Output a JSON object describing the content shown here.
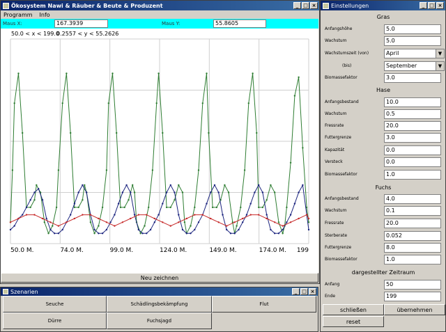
{
  "main": {
    "title": "Ökosystem Nawi  &  Räuber  &  Beute  &  Produzent",
    "menu": [
      "Programm",
      "Info"
    ],
    "mouse_x_label": "Maus X:",
    "mouse_x_value": "167.3939",
    "mouse_y_label": "Maus Y:",
    "mouse_y_value": "55.8605",
    "range_x": "50.0 < x < 199.0",
    "range_y": "0.2557 < y < 55.2626",
    "redraw_label": "Neu zeichnen"
  },
  "chart_data": {
    "type": "line",
    "x_ticks": [
      "50.0 M.",
      "74.0 M.",
      "99.0 M.",
      "124.0 M.",
      "149.0 M.",
      "174.0 M.",
      "199"
    ],
    "xlim": [
      50,
      199
    ],
    "ylim": [
      0.2557,
      55.2626
    ],
    "grid": true,
    "series": [
      {
        "color": "#2e7d32",
        "x": [
          50,
          51,
          52,
          54,
          56,
          58,
          60,
          62,
          63,
          65,
          67,
          69,
          71,
          73,
          74,
          76,
          78,
          80,
          82,
          84,
          86,
          87,
          88,
          90,
          92,
          94,
          96,
          98,
          99,
          101,
          103,
          105,
          107,
          109,
          111,
          112,
          113,
          115,
          117,
          119,
          121,
          123,
          124,
          126,
          128,
          130,
          132,
          134,
          136,
          137,
          138,
          140,
          142,
          144,
          146,
          148,
          149,
          151,
          153,
          155,
          157,
          159,
          161,
          162,
          163,
          165,
          167,
          169,
          171,
          173,
          174,
          176,
          178,
          180,
          182,
          184,
          186,
          187,
          188,
          190,
          192,
          194,
          196,
          198,
          199
        ],
        "values": [
          6,
          20,
          38,
          46,
          30,
          10,
          10,
          12,
          16,
          14,
          6,
          3,
          5,
          10,
          20,
          38,
          46,
          30,
          10,
          10,
          12,
          16,
          14,
          6,
          3,
          5,
          10,
          20,
          38,
          46,
          30,
          10,
          10,
          12,
          16,
          14,
          6,
          3,
          5,
          10,
          20,
          38,
          46,
          30,
          10,
          10,
          12,
          16,
          14,
          6,
          3,
          5,
          10,
          20,
          38,
          46,
          30,
          10,
          10,
          12,
          16,
          14,
          6,
          3,
          5,
          10,
          20,
          38,
          46,
          30,
          10,
          10,
          12,
          16,
          14,
          6,
          3,
          5,
          10,
          22,
          40,
          45,
          26,
          10,
          6
        ]
      },
      {
        "color": "#1a237e",
        "x": [
          50,
          52,
          54,
          56,
          58,
          60,
          62,
          64,
          66,
          68,
          70,
          72,
          74,
          76,
          78,
          80,
          82,
          84,
          86,
          88,
          90,
          92,
          94,
          96,
          98,
          100,
          102,
          104,
          106,
          108,
          110,
          112,
          114,
          116,
          118,
          120,
          122,
          124,
          126,
          128,
          130,
          132,
          134,
          136,
          138,
          140,
          142,
          144,
          146,
          148,
          150,
          152,
          154,
          156,
          158,
          160,
          162,
          164,
          166,
          168,
          170,
          172,
          174,
          176,
          178,
          180,
          182,
          184,
          186,
          188,
          190,
          192,
          194,
          196,
          198,
          199
        ],
        "values": [
          4,
          5,
          7,
          8,
          10,
          12,
          14,
          15,
          12,
          7,
          4,
          3,
          3,
          4,
          6,
          8,
          11,
          14,
          16,
          14,
          8,
          4,
          3,
          3,
          4,
          6,
          8,
          11,
          14,
          16,
          14,
          8,
          4,
          3,
          3,
          4,
          6,
          8,
          11,
          14,
          16,
          14,
          8,
          4,
          3,
          3,
          4,
          6,
          8,
          11,
          14,
          16,
          14,
          8,
          4,
          3,
          3,
          4,
          6,
          8,
          11,
          14,
          16,
          14,
          8,
          4,
          3,
          3,
          4,
          6,
          8,
          11,
          14,
          16,
          8,
          4
        ]
      },
      {
        "color": "#c62828",
        "x": [
          50,
          54,
          58,
          62,
          66,
          70,
          74,
          78,
          82,
          86,
          90,
          94,
          98,
          102,
          106,
          110,
          114,
          118,
          122,
          126,
          130,
          134,
          138,
          142,
          146,
          150,
          154,
          158,
          162,
          166,
          170,
          174,
          178,
          182,
          186,
          190,
          194,
          198,
          199
        ],
        "values": [
          6,
          7,
          8,
          8,
          7,
          6,
          5,
          6,
          7,
          8,
          8,
          7,
          6,
          5,
          6,
          7,
          8,
          8,
          7,
          6,
          5,
          6,
          7,
          8,
          8,
          7,
          6,
          5,
          6,
          7,
          8,
          8,
          7,
          6,
          5,
          6,
          7,
          8,
          7
        ]
      }
    ]
  },
  "settings": {
    "title": "Einstellungen",
    "grass_header": "Gras",
    "grass": [
      {
        "label": "Anfangshöhe",
        "value": "5.0"
      },
      {
        "label": "Wachstum",
        "value": "5.0"
      }
    ],
    "growth_from_label": "Wachstumszeit (von)",
    "growth_from_value": "April",
    "growth_to_label": "(bis)",
    "growth_to_value": "September",
    "grass_bio_label": "Biomassefaktor",
    "grass_bio_value": "3.0",
    "hare_header": "Hase",
    "hare": [
      {
        "label": "Anfangsbestand",
        "value": "10.0"
      },
      {
        "label": "Wachstum",
        "value": "0.5"
      },
      {
        "label": "Fressrate",
        "value": "20.0"
      },
      {
        "label": "Futtergrenze",
        "value": "3.0"
      },
      {
        "label": "Kapazität",
        "value": "0.0"
      },
      {
        "label": "Versteck",
        "value": "0.0"
      },
      {
        "label": "Biomassefaktor",
        "value": "1.0"
      }
    ],
    "fox_header": "Fuchs",
    "fox": [
      {
        "label": "Anfangsbestand",
        "value": "4.0"
      },
      {
        "label": "Wachstum",
        "value": "0.1"
      },
      {
        "label": "Fressrate",
        "value": "20.0"
      },
      {
        "label": "Sterberate",
        "value": "0.052"
      },
      {
        "label": "Futtergrenze",
        "value": "8.0"
      },
      {
        "label": "Biomassefaktor",
        "value": "1.0"
      }
    ],
    "range_header": "dargestellter Zeitraum",
    "range": [
      {
        "label": "Anfang",
        "value": "50"
      },
      {
        "label": "Ende",
        "value": "199"
      }
    ],
    "close_label": "schließen",
    "apply_label": "übernehmen",
    "reset_label": "reset"
  },
  "scenarios": {
    "title": "Szenarien",
    "buttons": [
      "Seuche",
      "Schädlingsbekämpfung",
      "Flut",
      "Dürre",
      "Fuchsjagd"
    ]
  }
}
